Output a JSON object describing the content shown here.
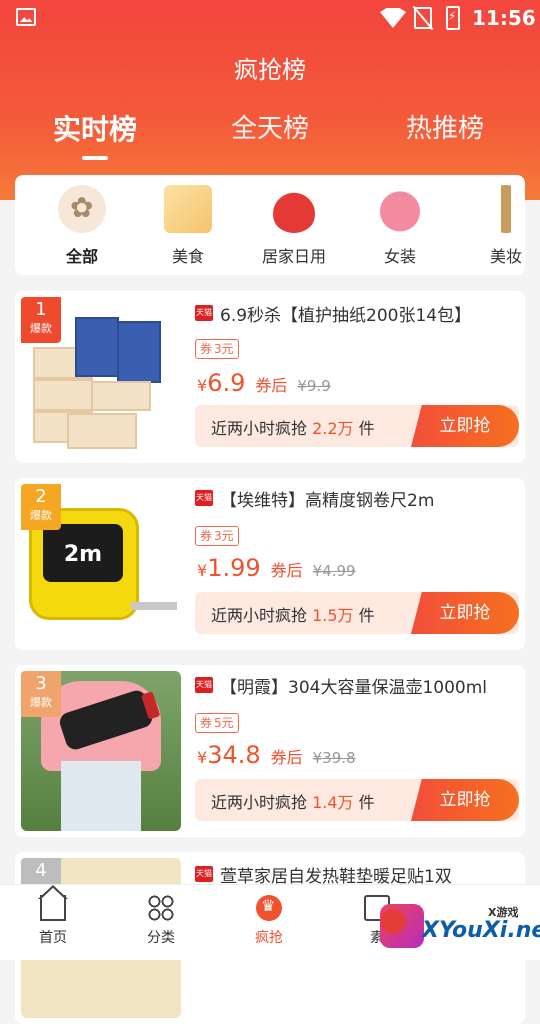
{
  "status_bar": {
    "time": "11:56"
  },
  "header": {
    "title": "疯抢榜",
    "tabs": [
      {
        "label": "实时榜"
      },
      {
        "label": "全天榜"
      },
      {
        "label": "热推榜"
      }
    ]
  },
  "categories": [
    {
      "label": "全部",
      "icon": "all-icon"
    },
    {
      "label": "美食",
      "icon": "food-icon"
    },
    {
      "label": "居家日用",
      "icon": "household-icon"
    },
    {
      "label": "女装",
      "icon": "women-clothing-icon"
    },
    {
      "label": "美妆",
      "icon": "beauty-icon"
    }
  ],
  "products": [
    {
      "rank": "1",
      "rank_tag": "爆款",
      "shop": "天猫",
      "title": "6.9秒杀【植护抽纸200张14包】",
      "coupon_word": "券",
      "coupon_value": "3元",
      "currency": "¥",
      "price": "6.9",
      "after_coupon": "券后",
      "original_price": "¥9.9",
      "grab_prefix": "近两小时疯抢",
      "grab_count": "2.2万",
      "grab_suffix": "件",
      "button": "立即抢"
    },
    {
      "rank": "2",
      "rank_tag": "爆款",
      "shop": "天猫",
      "title": "【埃维特】高精度钢卷尺2m",
      "coupon_word": "券",
      "coupon_value": "3元",
      "currency": "¥",
      "price": "1.99",
      "after_coupon": "券后",
      "original_price": "¥4.99",
      "grab_prefix": "近两小时疯抢",
      "grab_count": "1.5万",
      "grab_suffix": "件",
      "button": "立即抢",
      "thumb_text": "2m"
    },
    {
      "rank": "3",
      "rank_tag": "爆款",
      "shop": "天猫",
      "title": "【明霞】304大容量保温壶1000ml",
      "coupon_word": "券",
      "coupon_value": "5元",
      "currency": "¥",
      "price": "34.8",
      "after_coupon": "券后",
      "original_price": "¥39.8",
      "grab_prefix": "近两小时疯抢",
      "grab_count": "1.4万",
      "grab_suffix": "件",
      "button": "立即抢"
    },
    {
      "rank": "4",
      "shop": "天猫",
      "title": "萱草家居自发热鞋垫暖足贴1双"
    }
  ],
  "bottom_nav": [
    {
      "label": "首页"
    },
    {
      "label": "分类"
    },
    {
      "label": "疯抢"
    },
    {
      "label": "素"
    }
  ],
  "watermark": {
    "small": "X游戏",
    "big": "XYouXi.net"
  },
  "colors": {
    "primary": "#f0522e",
    "header_top": "#f2453e",
    "header_bottom": "#f67a3a",
    "grab_bg": "#fde9e0"
  }
}
